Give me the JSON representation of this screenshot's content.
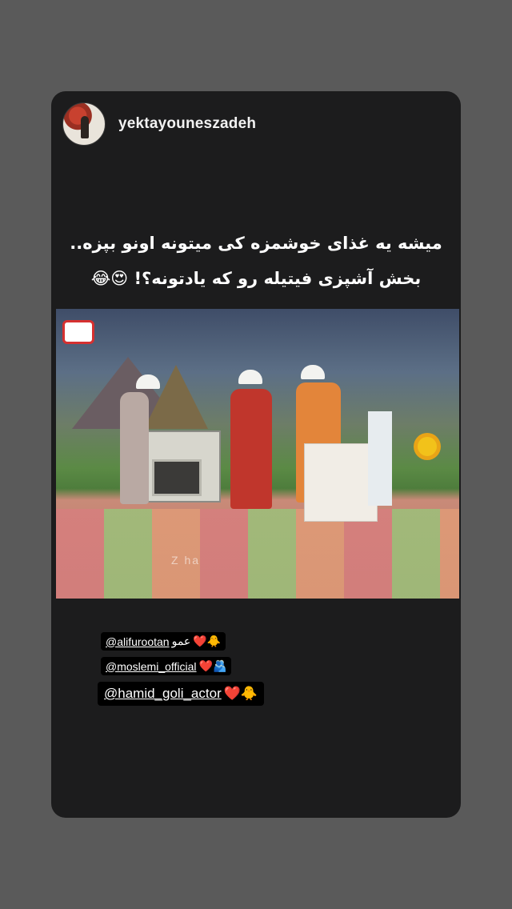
{
  "header": {
    "username": "yektayouneszadeh"
  },
  "caption": {
    "line1": "میشه یه غذای خوشمزه کی میتونه اونو بپزه..",
    "line2": "بخش آشپزی فیتیله رو که یادتونه؟! 😍😂"
  },
  "video": {
    "watermark": "Z          ha"
  },
  "mentions": [
    {
      "handle": "@alifurootan",
      "suffix": "عمو",
      "emoji": "❤️🐥"
    },
    {
      "handle": "@moslemi_official",
      "suffix": "",
      "emoji": "❤️🫂"
    },
    {
      "handle": "@hamid_goli_actor",
      "suffix": "",
      "emoji": "❤️🐥"
    }
  ],
  "colors": {
    "background": "#5a5a5a",
    "card": "#1c1c1d",
    "heart": "#ff2b2b"
  }
}
